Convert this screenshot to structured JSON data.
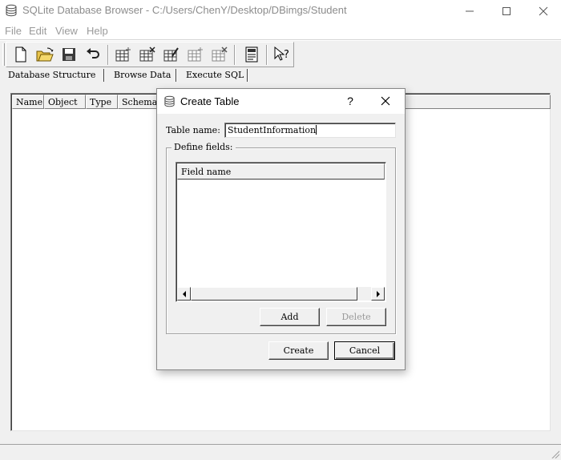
{
  "window": {
    "title": "SQLite Database Browser - C:/Users/ChenY/Desktop/DBimgs/Student",
    "icon": "database-icon"
  },
  "menu": [
    "File",
    "Edit",
    "View",
    "Help"
  ],
  "toolbar": {
    "buttons": [
      "new-database",
      "open-database",
      "save-database",
      "revert-changes",
      "create-table",
      "delete-table",
      "modify-table",
      "create-index",
      "delete-index",
      "sql-log",
      "whats-this"
    ]
  },
  "tabs": [
    "Database Structure",
    "Browse Data",
    "Execute SQL"
  ],
  "structure": {
    "columns": [
      "Name",
      "Object",
      "Type",
      "Schema"
    ]
  },
  "dialog": {
    "title": "Create Table",
    "help": "?",
    "table_name_label": "Table name:",
    "table_name_value": "StudentInformation",
    "define_fields_label": "Define fields:",
    "field_column": "Field name",
    "add": "Add",
    "delete": "Delete",
    "create": "Create",
    "cancel": "Cancel"
  }
}
